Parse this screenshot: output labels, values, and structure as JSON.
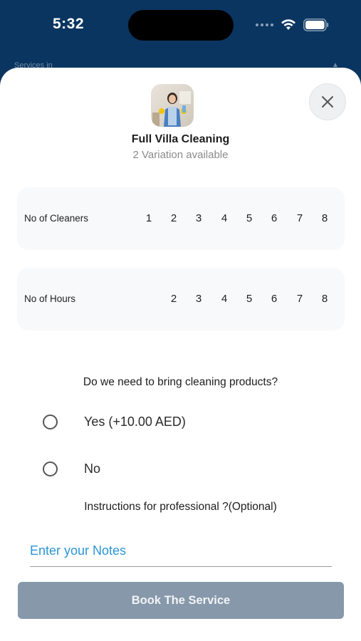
{
  "status_bar": {
    "time": "5:32"
  },
  "background": {
    "partial_text": "Services in"
  },
  "service": {
    "title": "Full Villa Cleaning",
    "subtitle": "2 Variation available"
  },
  "cleaners": {
    "label": "No of Cleaners",
    "options": [
      "1",
      "2",
      "3",
      "4",
      "5",
      "6",
      "7",
      "8"
    ]
  },
  "hours": {
    "label": "No of Hours",
    "options": [
      "2",
      "3",
      "4",
      "5",
      "6",
      "7",
      "8"
    ]
  },
  "products_question": {
    "question": "Do we need to bring cleaning products?",
    "options": [
      "Yes (+10.00 AED)",
      "No"
    ]
  },
  "instructions": {
    "label": "Instructions for professional ?(Optional)",
    "placeholder": "Enter your Notes",
    "value": ""
  },
  "book_button": {
    "label": "Book The Service"
  },
  "colors": {
    "header_bg": "#0a3560",
    "button_bg": "#8798ab",
    "placeholder": "#2a95d6"
  }
}
